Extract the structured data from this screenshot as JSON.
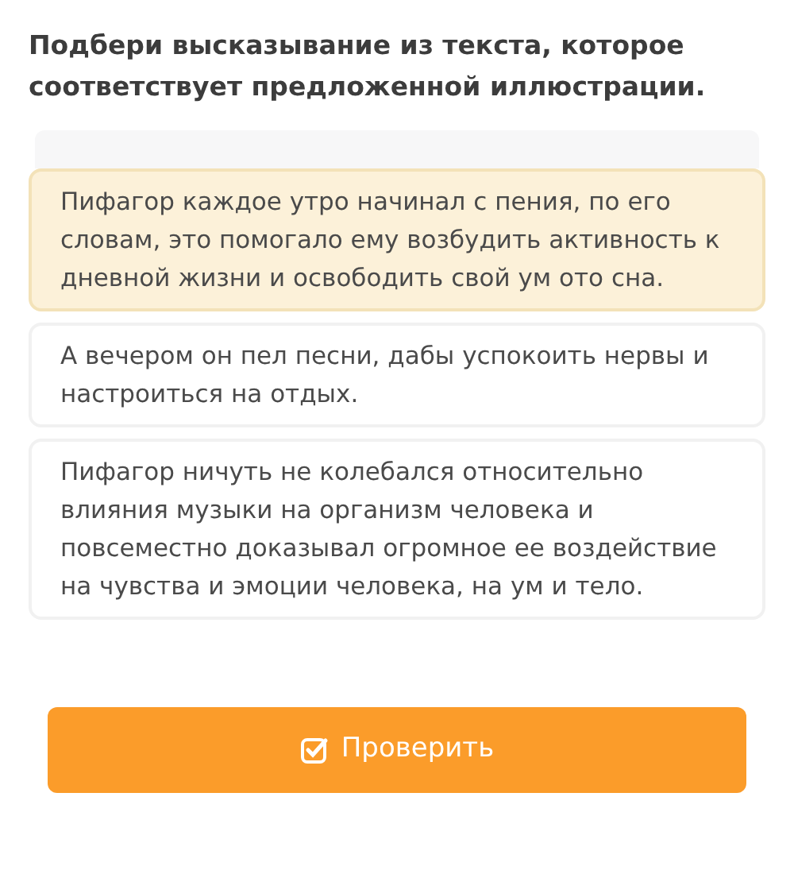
{
  "question": "Подбери высказывание из текста, которое соответствует предложенной иллюстрации.",
  "options": [
    {
      "text": "Пифагор каждое утро начинал с пения, по его словам, это помогало ему возбудить активность к дневной жизни и освободить свой ум ото сна.",
      "selected": true
    },
    {
      "text": "А вечером он пел песни, дабы успокоить нервы и настроиться на отдых.",
      "selected": false
    },
    {
      "text": "Пифагор ничуть не колебался относительно влияния музыки на организм человека и повсеместно доказывал огромное ее воздействие на чувства и эмоции человека, на ум и тело.",
      "selected": false
    }
  ],
  "check_button": {
    "label": "Проверить"
  }
}
